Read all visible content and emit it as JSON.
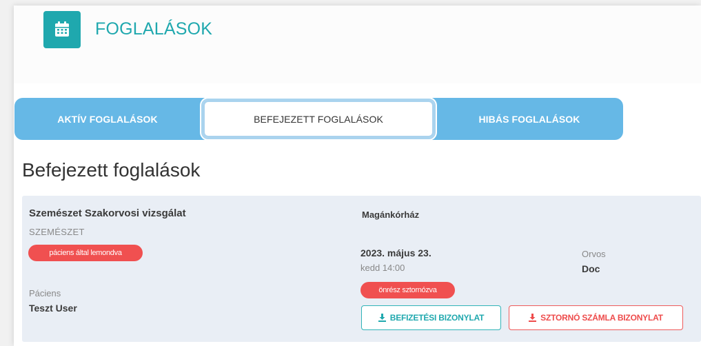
{
  "header": {
    "icon": "calendar-icon",
    "title": "FOGLALÁSOK",
    "accent_color": "#1fa8ae"
  },
  "tabs": [
    {
      "label": "AKTÍV FOGLALÁSOK",
      "active": false
    },
    {
      "label": "BEFEJEZETT FOGLALÁSOK",
      "active": true
    },
    {
      "label": "HIBÁS FOGLALÁSOK",
      "active": false
    }
  ],
  "tabs_color": "#66b8e6",
  "section": {
    "title": "Befejezett foglalások"
  },
  "booking": {
    "title": "Szemészet Szakorvosi vizsgálat",
    "category": "SZEMÉSZET",
    "status_badge": "páciens által lemondva",
    "patient_label": "Páciens",
    "patient_name": "Teszt User",
    "location": "Magánkórház",
    "date": "2023. május 23.",
    "time": "kedd 14:00",
    "doctor_label": "Orvos",
    "doctor_name": "Doc",
    "copay_badge": "önrész sztornózva",
    "buttons": {
      "payment_receipt": "BEFIZETÉSI BIZONYLAT",
      "storno_receipt": "SZTORNÓ SZÁMLA BIZONYLAT"
    },
    "badge_color": "#f05050"
  }
}
